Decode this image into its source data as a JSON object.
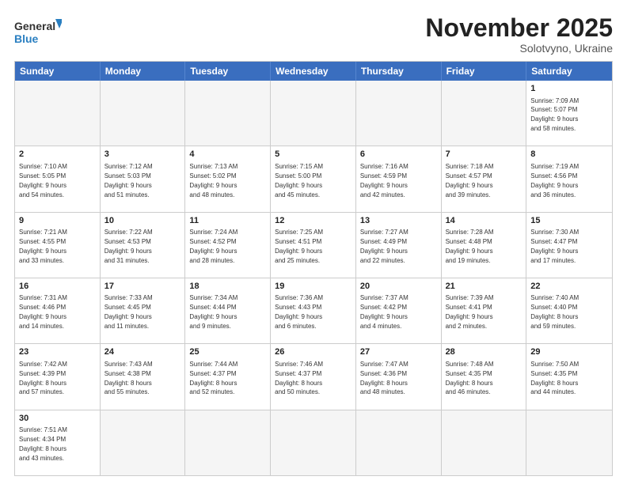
{
  "header": {
    "logo_general": "General",
    "logo_blue": "Blue",
    "month_title": "November 2025",
    "subtitle": "Solotvyno, Ukraine"
  },
  "days_of_week": [
    "Sunday",
    "Monday",
    "Tuesday",
    "Wednesday",
    "Thursday",
    "Friday",
    "Saturday"
  ],
  "weeks": [
    [
      {
        "day": "",
        "info": ""
      },
      {
        "day": "",
        "info": ""
      },
      {
        "day": "",
        "info": ""
      },
      {
        "day": "",
        "info": ""
      },
      {
        "day": "",
        "info": ""
      },
      {
        "day": "",
        "info": ""
      },
      {
        "day": "1",
        "info": "Sunrise: 7:09 AM\nSunset: 5:07 PM\nDaylight: 9 hours\nand 58 minutes."
      }
    ],
    [
      {
        "day": "2",
        "info": "Sunrise: 7:10 AM\nSunset: 5:05 PM\nDaylight: 9 hours\nand 54 minutes."
      },
      {
        "day": "3",
        "info": "Sunrise: 7:12 AM\nSunset: 5:03 PM\nDaylight: 9 hours\nand 51 minutes."
      },
      {
        "day": "4",
        "info": "Sunrise: 7:13 AM\nSunset: 5:02 PM\nDaylight: 9 hours\nand 48 minutes."
      },
      {
        "day": "5",
        "info": "Sunrise: 7:15 AM\nSunset: 5:00 PM\nDaylight: 9 hours\nand 45 minutes."
      },
      {
        "day": "6",
        "info": "Sunrise: 7:16 AM\nSunset: 4:59 PM\nDaylight: 9 hours\nand 42 minutes."
      },
      {
        "day": "7",
        "info": "Sunrise: 7:18 AM\nSunset: 4:57 PM\nDaylight: 9 hours\nand 39 minutes."
      },
      {
        "day": "8",
        "info": "Sunrise: 7:19 AM\nSunset: 4:56 PM\nDaylight: 9 hours\nand 36 minutes."
      }
    ],
    [
      {
        "day": "9",
        "info": "Sunrise: 7:21 AM\nSunset: 4:55 PM\nDaylight: 9 hours\nand 33 minutes."
      },
      {
        "day": "10",
        "info": "Sunrise: 7:22 AM\nSunset: 4:53 PM\nDaylight: 9 hours\nand 31 minutes."
      },
      {
        "day": "11",
        "info": "Sunrise: 7:24 AM\nSunset: 4:52 PM\nDaylight: 9 hours\nand 28 minutes."
      },
      {
        "day": "12",
        "info": "Sunrise: 7:25 AM\nSunset: 4:51 PM\nDaylight: 9 hours\nand 25 minutes."
      },
      {
        "day": "13",
        "info": "Sunrise: 7:27 AM\nSunset: 4:49 PM\nDaylight: 9 hours\nand 22 minutes."
      },
      {
        "day": "14",
        "info": "Sunrise: 7:28 AM\nSunset: 4:48 PM\nDaylight: 9 hours\nand 19 minutes."
      },
      {
        "day": "15",
        "info": "Sunrise: 7:30 AM\nSunset: 4:47 PM\nDaylight: 9 hours\nand 17 minutes."
      }
    ],
    [
      {
        "day": "16",
        "info": "Sunrise: 7:31 AM\nSunset: 4:46 PM\nDaylight: 9 hours\nand 14 minutes."
      },
      {
        "day": "17",
        "info": "Sunrise: 7:33 AM\nSunset: 4:45 PM\nDaylight: 9 hours\nand 11 minutes."
      },
      {
        "day": "18",
        "info": "Sunrise: 7:34 AM\nSunset: 4:44 PM\nDaylight: 9 hours\nand 9 minutes."
      },
      {
        "day": "19",
        "info": "Sunrise: 7:36 AM\nSunset: 4:43 PM\nDaylight: 9 hours\nand 6 minutes."
      },
      {
        "day": "20",
        "info": "Sunrise: 7:37 AM\nSunset: 4:42 PM\nDaylight: 9 hours\nand 4 minutes."
      },
      {
        "day": "21",
        "info": "Sunrise: 7:39 AM\nSunset: 4:41 PM\nDaylight: 9 hours\nand 2 minutes."
      },
      {
        "day": "22",
        "info": "Sunrise: 7:40 AM\nSunset: 4:40 PM\nDaylight: 8 hours\nand 59 minutes."
      }
    ],
    [
      {
        "day": "23",
        "info": "Sunrise: 7:42 AM\nSunset: 4:39 PM\nDaylight: 8 hours\nand 57 minutes."
      },
      {
        "day": "24",
        "info": "Sunrise: 7:43 AM\nSunset: 4:38 PM\nDaylight: 8 hours\nand 55 minutes."
      },
      {
        "day": "25",
        "info": "Sunrise: 7:44 AM\nSunset: 4:37 PM\nDaylight: 8 hours\nand 52 minutes."
      },
      {
        "day": "26",
        "info": "Sunrise: 7:46 AM\nSunset: 4:37 PM\nDaylight: 8 hours\nand 50 minutes."
      },
      {
        "day": "27",
        "info": "Sunrise: 7:47 AM\nSunset: 4:36 PM\nDaylight: 8 hours\nand 48 minutes."
      },
      {
        "day": "28",
        "info": "Sunrise: 7:48 AM\nSunset: 4:35 PM\nDaylight: 8 hours\nand 46 minutes."
      },
      {
        "day": "29",
        "info": "Sunrise: 7:50 AM\nSunset: 4:35 PM\nDaylight: 8 hours\nand 44 minutes."
      }
    ],
    [
      {
        "day": "30",
        "info": "Sunrise: 7:51 AM\nSunset: 4:34 PM\nDaylight: 8 hours\nand 43 minutes."
      },
      {
        "day": "",
        "info": ""
      },
      {
        "day": "",
        "info": ""
      },
      {
        "day": "",
        "info": ""
      },
      {
        "day": "",
        "info": ""
      },
      {
        "day": "",
        "info": ""
      },
      {
        "day": "",
        "info": ""
      }
    ]
  ]
}
